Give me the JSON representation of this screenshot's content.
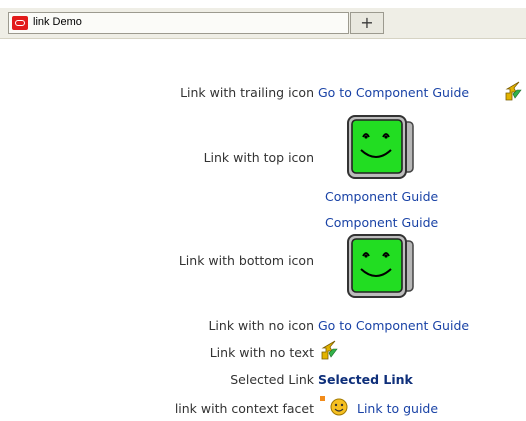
{
  "tabbar": {
    "tab_title": "link Demo",
    "new_tab_glyph": "+"
  },
  "rows": {
    "trailing": {
      "label": "Link with trailing icon",
      "link": "Go to Component Guide",
      "icon": "component-guide-arrow-icon"
    },
    "top": {
      "label": "Link with top icon",
      "link": "Component Guide",
      "icon": "smiley-monitor-icon"
    },
    "bottom": {
      "label": "Link with bottom icon",
      "link": "Component Guide",
      "icon": "smiley-monitor-icon"
    },
    "noicon": {
      "label": "Link with no icon",
      "link": "Go to Component Guide"
    },
    "notext": {
      "label": "Link with no text",
      "icon": "component-guide-arrow-icon"
    },
    "selected": {
      "label": "Selected Link",
      "link": "Selected Link"
    },
    "context": {
      "label": "link with context facet",
      "link": "Link to guide",
      "icon": "smiley-face-icon"
    }
  },
  "colors": {
    "link": "#1a43a6",
    "screen": "#22dd22"
  }
}
